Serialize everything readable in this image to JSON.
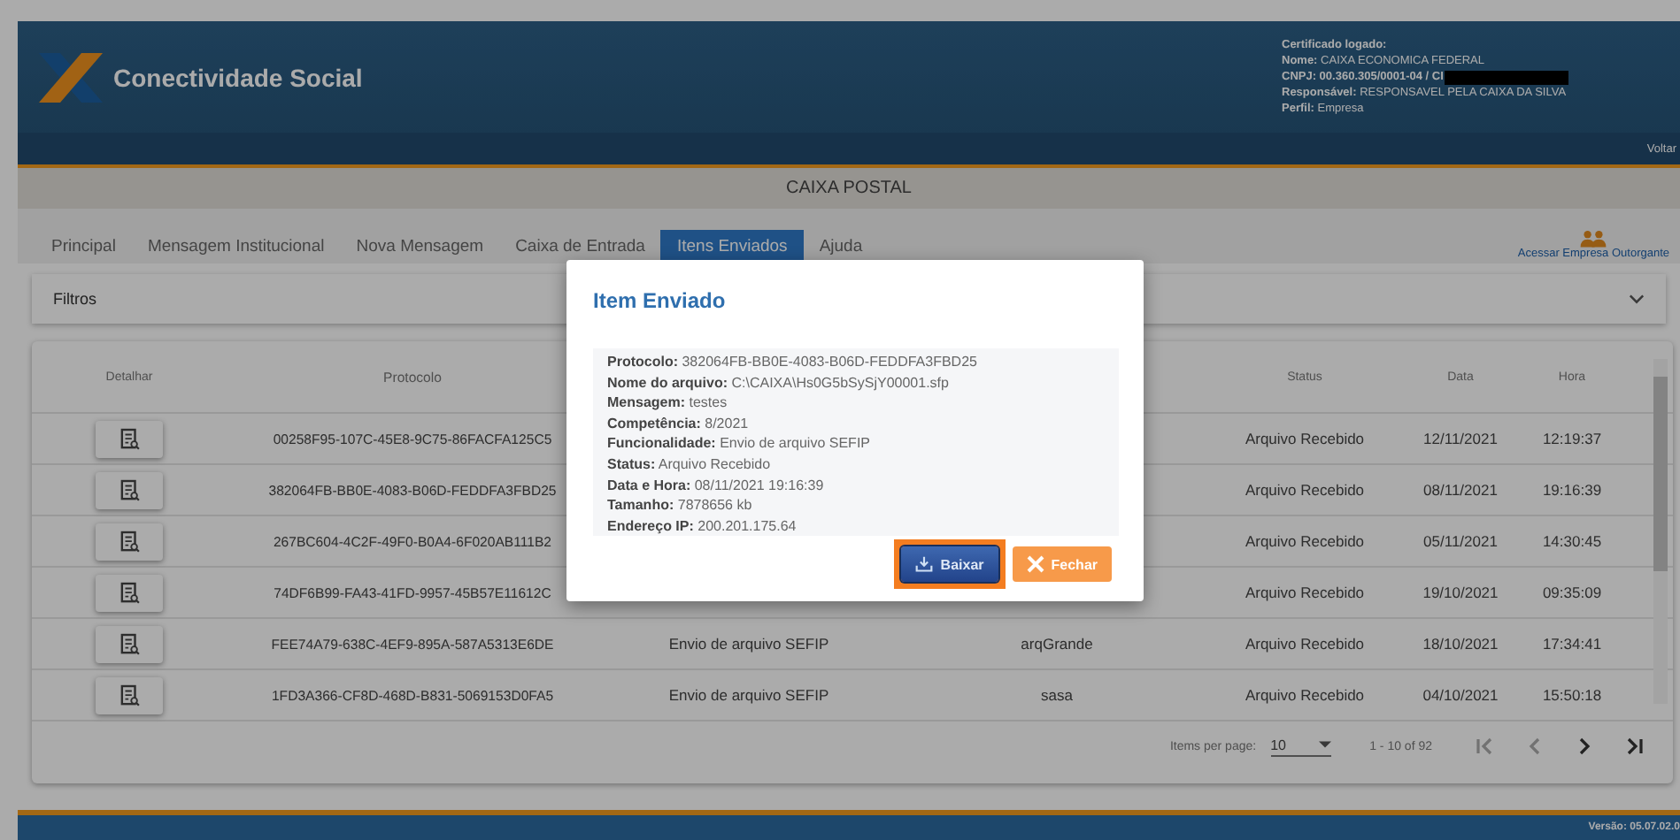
{
  "header": {
    "app_name": "Conectividade Social",
    "certificate": [
      {
        "text": "**Certificado logado:**"
      },
      {
        "text": "**Nome:** CAIXA ECONOMICA FEDERAL"
      },
      {
        "text": "**CNPJ: 00.360.305/0001-04 / CI**",
        "redacted": true
      },
      {
        "text": "**Responsável:** RESPONSAVEL PELA CAIXA DA SILVA"
      },
      {
        "text": "**Perfil:** Empresa"
      }
    ]
  },
  "nav": {
    "back_link": "Voltar"
  },
  "page_title": "CAIXA POSTAL",
  "tabs": [
    {
      "label": "Principal",
      "selected": false
    },
    {
      "label": "Mensagem Institucional",
      "selected": false
    },
    {
      "label": "Nova Mensagem",
      "selected": false
    },
    {
      "label": "Caixa de Entrada",
      "selected": false
    },
    {
      "label": "Itens Enviados",
      "selected": true
    },
    {
      "label": "Ajuda",
      "selected": false
    }
  ],
  "company_link": "Acessar Empresa Outorgante",
  "filters": {
    "label": "Filtros",
    "expanded": false
  },
  "table": {
    "columns": [
      "Detalhar",
      "Protocolo",
      "Status",
      "Data",
      "Hora"
    ],
    "rows": [
      {
        "protocolo": "00258F95-107C-45E8-9C75-86FACFA125C5",
        "status": "Arquivo Recebido",
        "data": "12/11/2021",
        "hora": "12:19:37"
      },
      {
        "protocolo": "382064FB-BB0E-4083-B06D-FEDDFA3FBD25",
        "status": "Arquivo Recebido",
        "data": "08/11/2021",
        "hora": "19:16:39"
      },
      {
        "protocolo": "267BC604-4C2F-49F0-B0A4-6F020AB111B2",
        "status": "Arquivo Recebido",
        "data": "05/11/2021",
        "hora": "14:30:45"
      },
      {
        "protocolo": "74DF6B99-FA43-41FD-9957-45B57E11612C",
        "status": "Arquivo Recebido",
        "data": "19/10/2021",
        "hora": "09:35:09"
      },
      {
        "protocolo": "FEE74A79-638C-4EF9-895A-587A5313E6DE",
        "column_3": "Envio de arquivo SEFIP",
        "column_4": "arqGrande",
        "status": "Arquivo Recebido",
        "data": "18/10/2021",
        "hora": "17:34:41"
      },
      {
        "protocolo": "1FD3A366-CF8D-468D-B831-5069153D0FA5",
        "column_3": "Envio de arquivo SEFIP",
        "column_4": "sasa",
        "status": "Arquivo Recebido",
        "data": "04/10/2021",
        "hora": "15:50:18"
      }
    ],
    "paginator": {
      "label": "Items per page:",
      "page_size": "10",
      "range": "1 - 10 of 92",
      "first_disabled": true,
      "previous_disabled": true,
      "next_disabled": false,
      "last_disabled": false
    }
  },
  "footer": {
    "version": "Versão: 05.07.02.0"
  },
  "dialog": {
    "title": "Item Enviado",
    "details": [
      "**Protocolo:** 382064FB-BB0E-4083-B06D-FEDDFA3FBD25",
      "**Nome do arquivo:** C:\\CAIXA\\Hs0G5bSySjY00001.sfp",
      "**Mensagem:** testes",
      "**Competência:** 8/2021",
      "**Funcionalidade:** Envio de arquivo SEFIP",
      "**Status:** Arquivo Recebido",
      "**Data e Hora:** 08/11/2021 19:16:39",
      "**Tamanho:** 7878656 kb",
      "**Endereço IP:** 200.201.175.64"
    ],
    "buttons": [
      {
        "label": "Baixar",
        "kind": "download",
        "focused": true
      },
      {
        "label": "Fechar",
        "kind": "close",
        "focused": false
      }
    ]
  }
}
